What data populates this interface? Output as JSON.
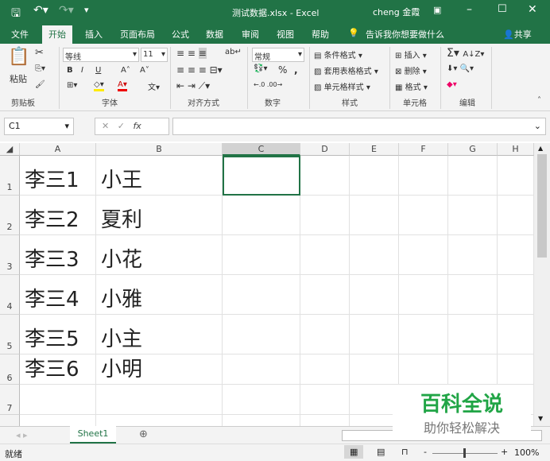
{
  "title": {
    "filename": "测试数据.xlsx",
    "sep": "-",
    "app": "Excel",
    "user": "cheng 金霞"
  },
  "tabs": [
    "文件",
    "开始",
    "插入",
    "页面布局",
    "公式",
    "数据",
    "审阅",
    "视图",
    "帮助"
  ],
  "tell_me": "告诉我你想要做什么",
  "share": "共享",
  "ribbon": {
    "paste": "粘贴",
    "font_name": "等线",
    "font_size": "11",
    "number_format": "常规",
    "conditional": "条件格式",
    "table_format": "套用表格格式",
    "cell_style": "单元格样式",
    "insert": "插入",
    "delete": "删除",
    "format": "格式",
    "bold": "B",
    "italic": "I",
    "underline": "U",
    "percent": "%",
    "comma": ",",
    "groups": [
      "剪贴板",
      "字体",
      "对齐方式",
      "数字",
      "样式",
      "单元格",
      "编辑"
    ]
  },
  "formula": {
    "name_box": "C1",
    "fx": "fx",
    "value": ""
  },
  "columns": [
    "A",
    "B",
    "C",
    "D",
    "E",
    "F",
    "G",
    "H"
  ],
  "rows": [
    {
      "n": "1",
      "a": "李三1",
      "b": "小王"
    },
    {
      "n": "2",
      "a": "李三2",
      "b": "夏利"
    },
    {
      "n": "3",
      "a": "李三3",
      "b": "小花"
    },
    {
      "n": "4",
      "a": "李三4",
      "b": "小雅"
    },
    {
      "n": "5",
      "a": "李三5",
      "b": "小主"
    },
    {
      "n": "6",
      "a": "李三6",
      "b": "小明"
    },
    {
      "n": "7",
      "a": "",
      "b": ""
    }
  ],
  "sheet_tab": "Sheet1",
  "status": {
    "ready": "就绪",
    "zoom": "100%"
  },
  "watermark": {
    "title": "百科全说",
    "subtitle": "助你轻松解决"
  },
  "colors": {
    "brand": "#217346"
  }
}
